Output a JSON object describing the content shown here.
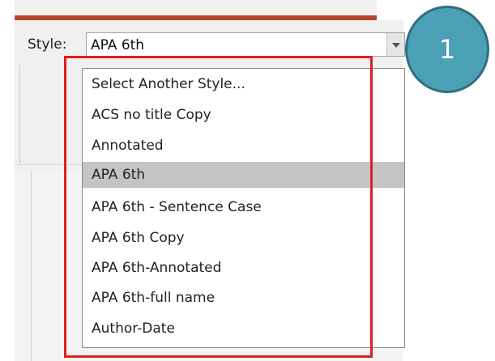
{
  "style_field": {
    "label": "Style:",
    "value": "APA 6th"
  },
  "dropdown": {
    "items": [
      {
        "label": "Select Another Style...",
        "selected": false
      },
      {
        "label": "ACS no title Copy",
        "selected": false
      },
      {
        "label": "Annotated",
        "selected": false
      },
      {
        "label": "APA 6th",
        "selected": true
      },
      {
        "label": "APA 6th - Sentence Case",
        "selected": false
      },
      {
        "label": "APA 6th Copy",
        "selected": false
      },
      {
        "label": "APA 6th-Annotated",
        "selected": false
      },
      {
        "label": "APA 6th-full name",
        "selected": false
      },
      {
        "label": "Author-Date",
        "selected": false
      }
    ]
  },
  "callout": {
    "number": "1"
  },
  "colors": {
    "accent_strip": "#b7472a",
    "highlight_border": "#e51c1c",
    "callout_fill": "#4aa0b5",
    "selected_item_bg": "#c4c4c4"
  },
  "icons": {
    "combo_arrow": "chevron-down-icon"
  }
}
